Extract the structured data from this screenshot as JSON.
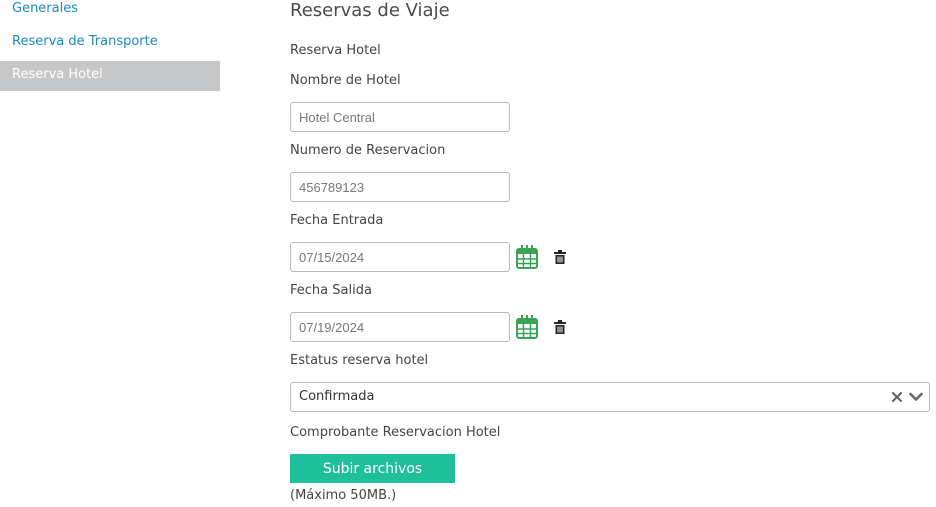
{
  "sidebar": {
    "items": [
      {
        "label": "Generales"
      },
      {
        "label": "Reserva de Transporte"
      },
      {
        "label": "Reserva Hotel"
      }
    ]
  },
  "main": {
    "title": "Reservas de Viaje",
    "section_label": "Reserva Hotel",
    "hotel_name": {
      "label": "Nombre de Hotel",
      "value": "Hotel Central"
    },
    "reservation_number": {
      "label": "Numero de Reservacion",
      "value": "456789123"
    },
    "check_in": {
      "label": "Fecha Entrada",
      "value": "07/15/2024"
    },
    "check_out": {
      "label": "Fecha Salida",
      "value": "07/19/2024"
    },
    "status": {
      "label": "Estatus reserva hotel",
      "value": "Confirmada"
    },
    "receipt": {
      "label": "Comprobante Reservacion Hotel",
      "upload_label": "Subir archivos",
      "note": "(Máximo 50MB.)"
    }
  },
  "icons": {
    "calendar": "calendar-icon",
    "trash": "trash-icon",
    "clear": "clear-icon",
    "dropdown": "chevron-down-icon"
  },
  "colors": {
    "link": "#1a8bc0",
    "active_nav_bg": "#c5c7c9",
    "calendar_green": "#3aa356",
    "upload_button": "#1fbf9a"
  }
}
